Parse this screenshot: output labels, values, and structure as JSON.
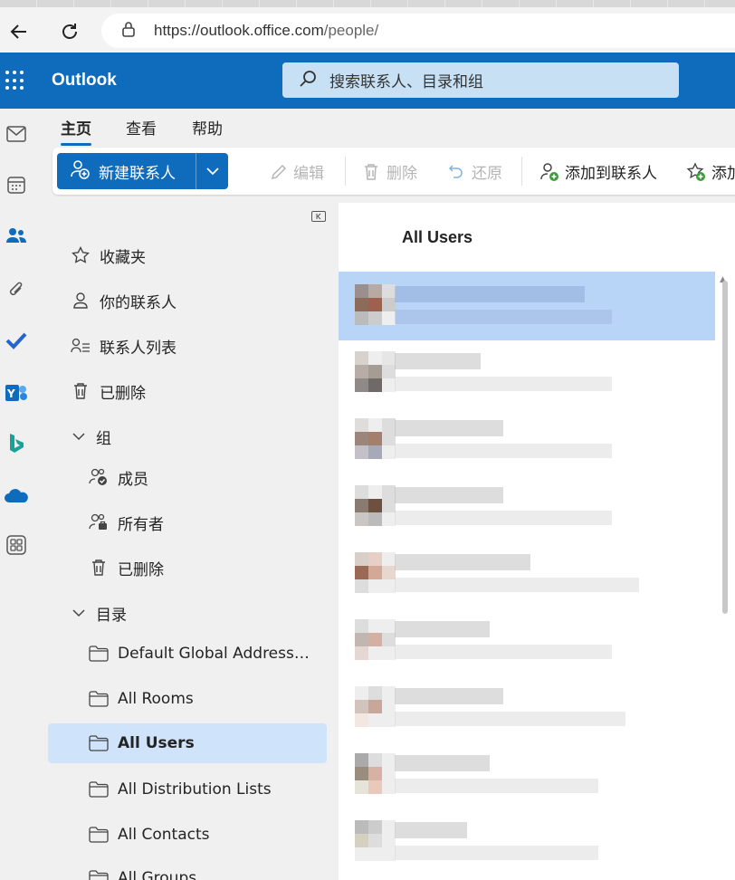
{
  "browser": {
    "url_prefix": "https://outlook.office.com",
    "url_path": "/people/"
  },
  "header": {
    "brand": "Outlook",
    "search_placeholder": "搜索联系人、目录和组"
  },
  "ribbon": {
    "tabs": [
      "主页",
      "查看",
      "帮助"
    ],
    "new_contact": "新建联系人",
    "edit": "编辑",
    "delete": "删除",
    "restore": "还原",
    "add_to_contacts": "添加到联系人",
    "add_partial": "添加"
  },
  "folders": {
    "favorites": "收藏夹",
    "your_contacts": "你的联系人",
    "contact_lists": "联系人列表",
    "deleted": "已删除",
    "groups": "组",
    "members": "成员",
    "owners": "所有者",
    "groups_deleted": "已删除",
    "directory": "目录",
    "default_gal": "Default Global Address List",
    "all_rooms": "All Rooms",
    "all_users": "All Users",
    "all_dls": "All Distribution Lists",
    "all_contacts": "All Contacts",
    "all_groups": "All Groups"
  },
  "list": {
    "title": "All Users"
  },
  "colors": {
    "brand_blue": "#0f6cbd",
    "search_bg": "#c7e0f4",
    "selected_folder": "#cfe4fa",
    "selected_row": "#b8d5f7"
  }
}
